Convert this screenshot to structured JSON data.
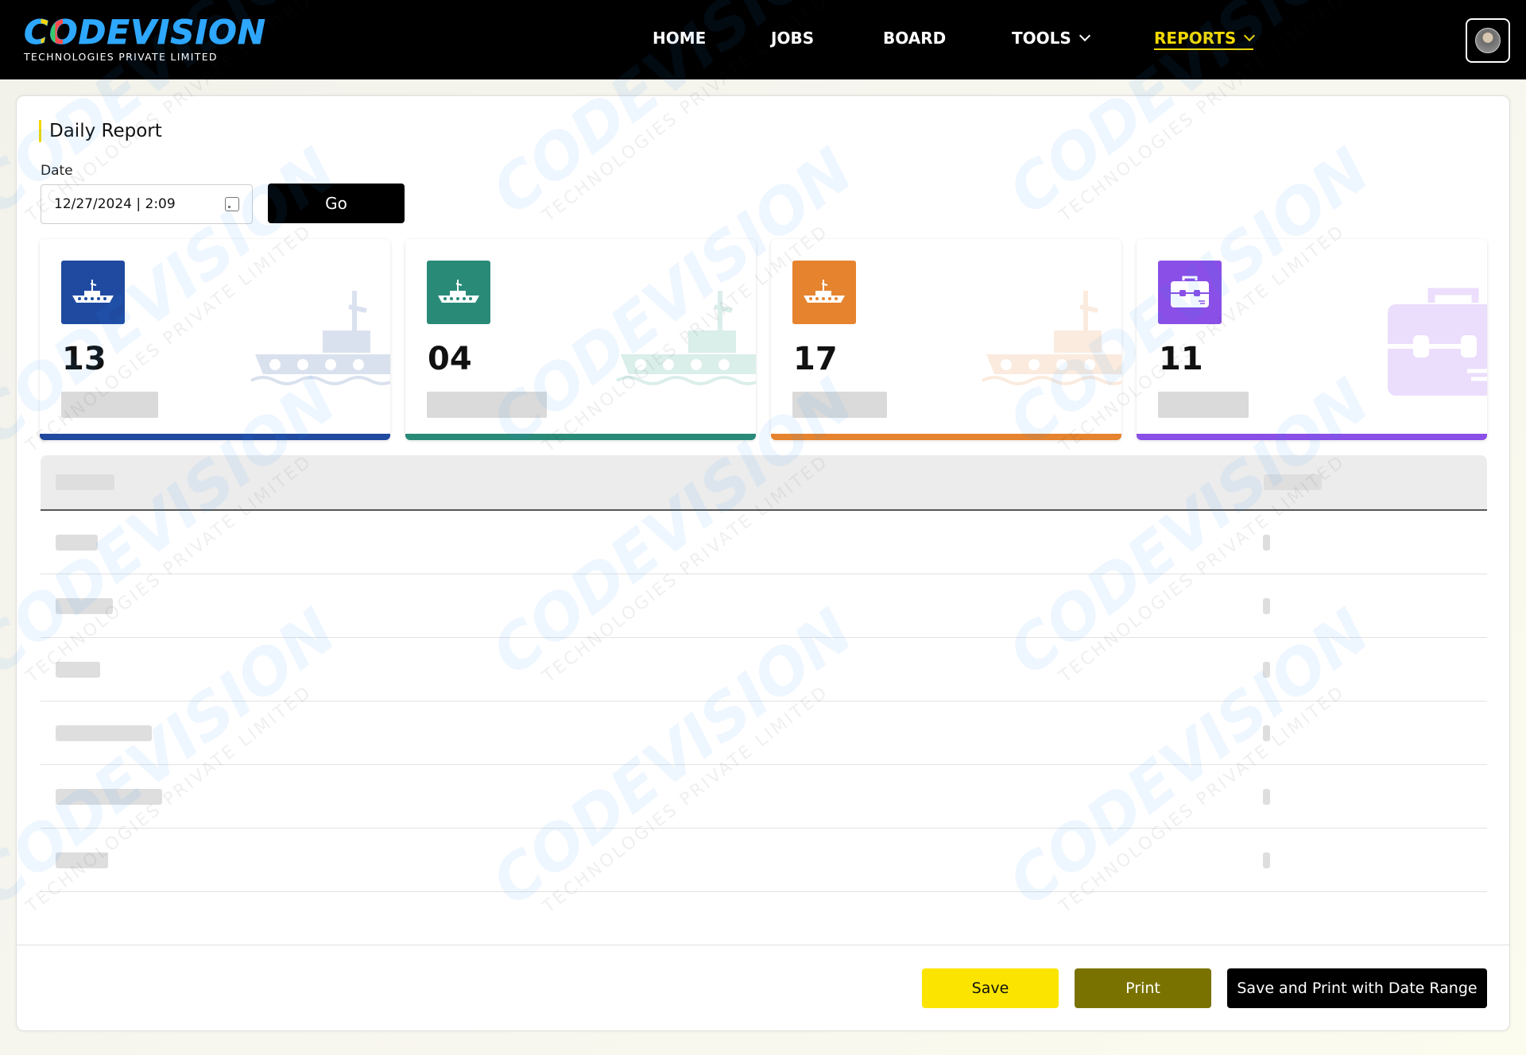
{
  "brand": {
    "name": "CODEVISION",
    "tagline": "TECHNOLOGIES PRIVATE LIMITED"
  },
  "nav": {
    "home": "HOME",
    "jobs": "JOBS",
    "board": "BOARD",
    "tools": "TOOLS",
    "reports": "REPORTS"
  },
  "page": {
    "title": "Daily Report",
    "date_label": "Date",
    "date_value": "12/27/2024 | 2:09",
    "go_label": "Go"
  },
  "stats": [
    {
      "value": "13",
      "icon": "tugboat-icon",
      "color": "#1f4aa0"
    },
    {
      "value": "04",
      "icon": "tugboat-icon",
      "color": "#2a8a78"
    },
    {
      "value": "17",
      "icon": "tugboat-icon",
      "color": "#e5832e"
    },
    {
      "value": "11",
      "icon": "briefcase-icon",
      "color": "#8a4fe6"
    }
  ],
  "footer": {
    "save_label": "Save",
    "print_label": "Print",
    "range_label": "Save and Print with Date Range"
  }
}
